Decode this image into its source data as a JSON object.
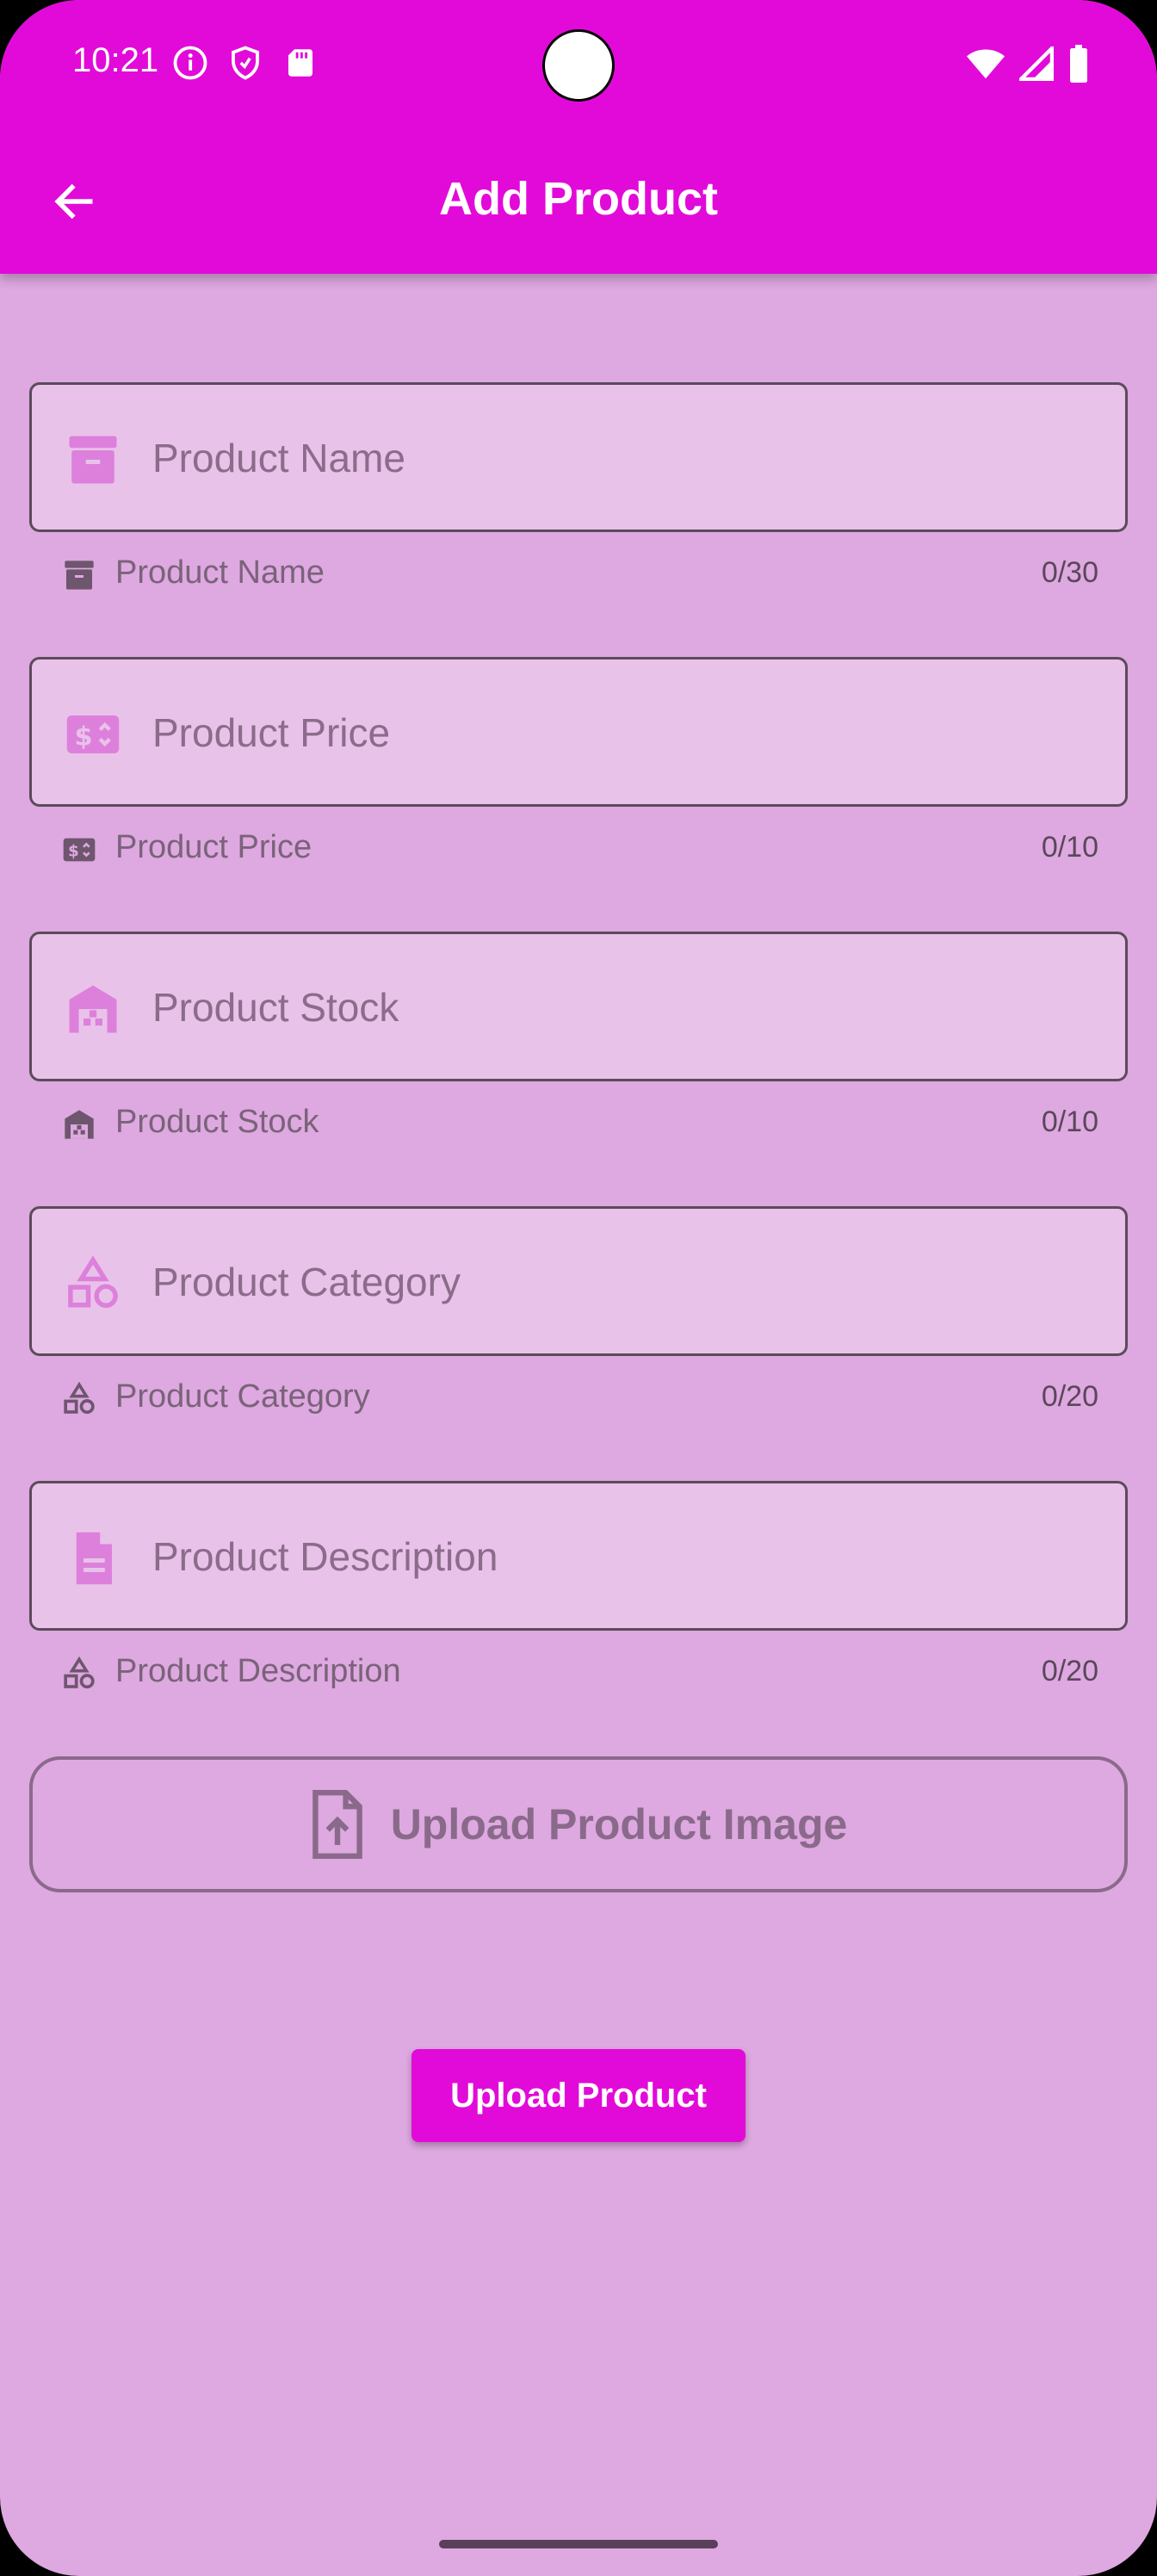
{
  "status_bar": {
    "time": "10:21",
    "left_icons": [
      "info-icon",
      "shield-icon",
      "sd-card-icon"
    ],
    "right_icons": [
      "wifi-icon",
      "signal-icon",
      "battery-icon"
    ]
  },
  "app_bar": {
    "title": "Add Product",
    "back_icon": "arrow-left-icon",
    "color": "#e20ad9"
  },
  "form": {
    "fields": [
      {
        "icon": "archive-icon",
        "placeholder": "Product Name",
        "helper_icon": "archive-icon",
        "helper_label": "Product Name",
        "counter": "0/30"
      },
      {
        "icon": "price-tag-icon",
        "placeholder": "Product Price",
        "helper_icon": "price-tag-icon",
        "helper_label": "Product Price",
        "counter": "0/10"
      },
      {
        "icon": "warehouse-icon",
        "placeholder": "Product Stock",
        "helper_icon": "warehouse-icon",
        "helper_label": "Product Stock",
        "counter": "0/10"
      },
      {
        "icon": "category-shapes-icon",
        "placeholder": "Product Category",
        "helper_icon": "category-shapes-icon",
        "helper_label": "Product Category",
        "counter": "0/20"
      },
      {
        "icon": "document-icon",
        "placeholder": "Product Description",
        "helper_icon": "category-shapes-icon",
        "helper_label": "Product Description",
        "counter": "0/20"
      }
    ],
    "upload_image_label": "Upload Product Image",
    "upload_image_icon": "file-upload-icon",
    "submit_label": "Upload Product"
  },
  "colors": {
    "background": "#dea8e0",
    "field_fill": "#e9c2e9",
    "accent": "#e20ad9",
    "icon": "#dd80dc"
  }
}
